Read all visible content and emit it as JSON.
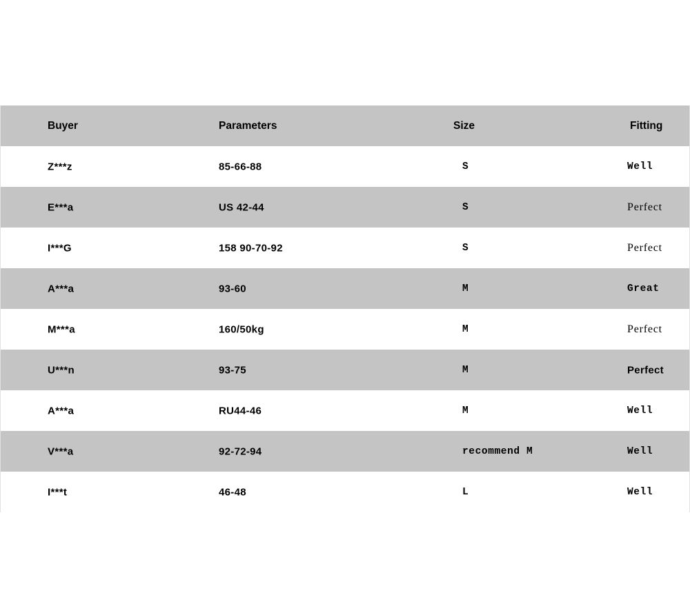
{
  "table": {
    "columns": [
      "Buyer",
      "Parameters",
      "Size",
      "Fitting"
    ],
    "header": {
      "buyer": "Buyer",
      "parameters": "Parameters",
      "size": "Size",
      "fitting": "Fitting"
    },
    "colors": {
      "shaded_row": "#c4c4c4",
      "plain_row": "#ffffff",
      "text": "#121212",
      "page_background": "#ffffff"
    },
    "rows": [
      {
        "buyer": "Z***z",
        "parameters": "85-66-88",
        "size": "S",
        "fitting": "Well",
        "shaded": false,
        "fitting_style": "bold-mono"
      },
      {
        "buyer": "E***a",
        "parameters": "US 42-44",
        "size": "S",
        "fitting": "Perfect",
        "shaded": true,
        "fitting_style": "serif"
      },
      {
        "buyer": "I***G",
        "parameters": "158 90-70-92",
        "size": "S",
        "fitting": "Perfect",
        "shaded": false,
        "fitting_style": "serif"
      },
      {
        "buyer": "A***a",
        "parameters": "93-60",
        "size": "M",
        "fitting": "Great",
        "shaded": true,
        "fitting_style": "bold-mono"
      },
      {
        "buyer": "M***a",
        "parameters": "160/50kg",
        "size": "M",
        "fitting": "Perfect",
        "shaded": false,
        "fitting_style": "serif"
      },
      {
        "buyer": "U***n",
        "parameters": "93-75",
        "size": "M",
        "fitting": "Perfect",
        "shaded": true,
        "fitting_style": "bold-cond"
      },
      {
        "buyer": "A***a",
        "parameters": "RU44-46",
        "size": "M",
        "fitting": "Well",
        "shaded": false,
        "fitting_style": "bold-mono"
      },
      {
        "buyer": "V***a",
        "parameters": "92-72-94",
        "size": "recommend M",
        "fitting": "Well",
        "shaded": true,
        "fitting_style": "bold-mono"
      },
      {
        "buyer": "I***t",
        "parameters": "46-48",
        "size": "L",
        "fitting": "Well",
        "shaded": false,
        "fitting_style": "bold-mono"
      }
    ]
  }
}
